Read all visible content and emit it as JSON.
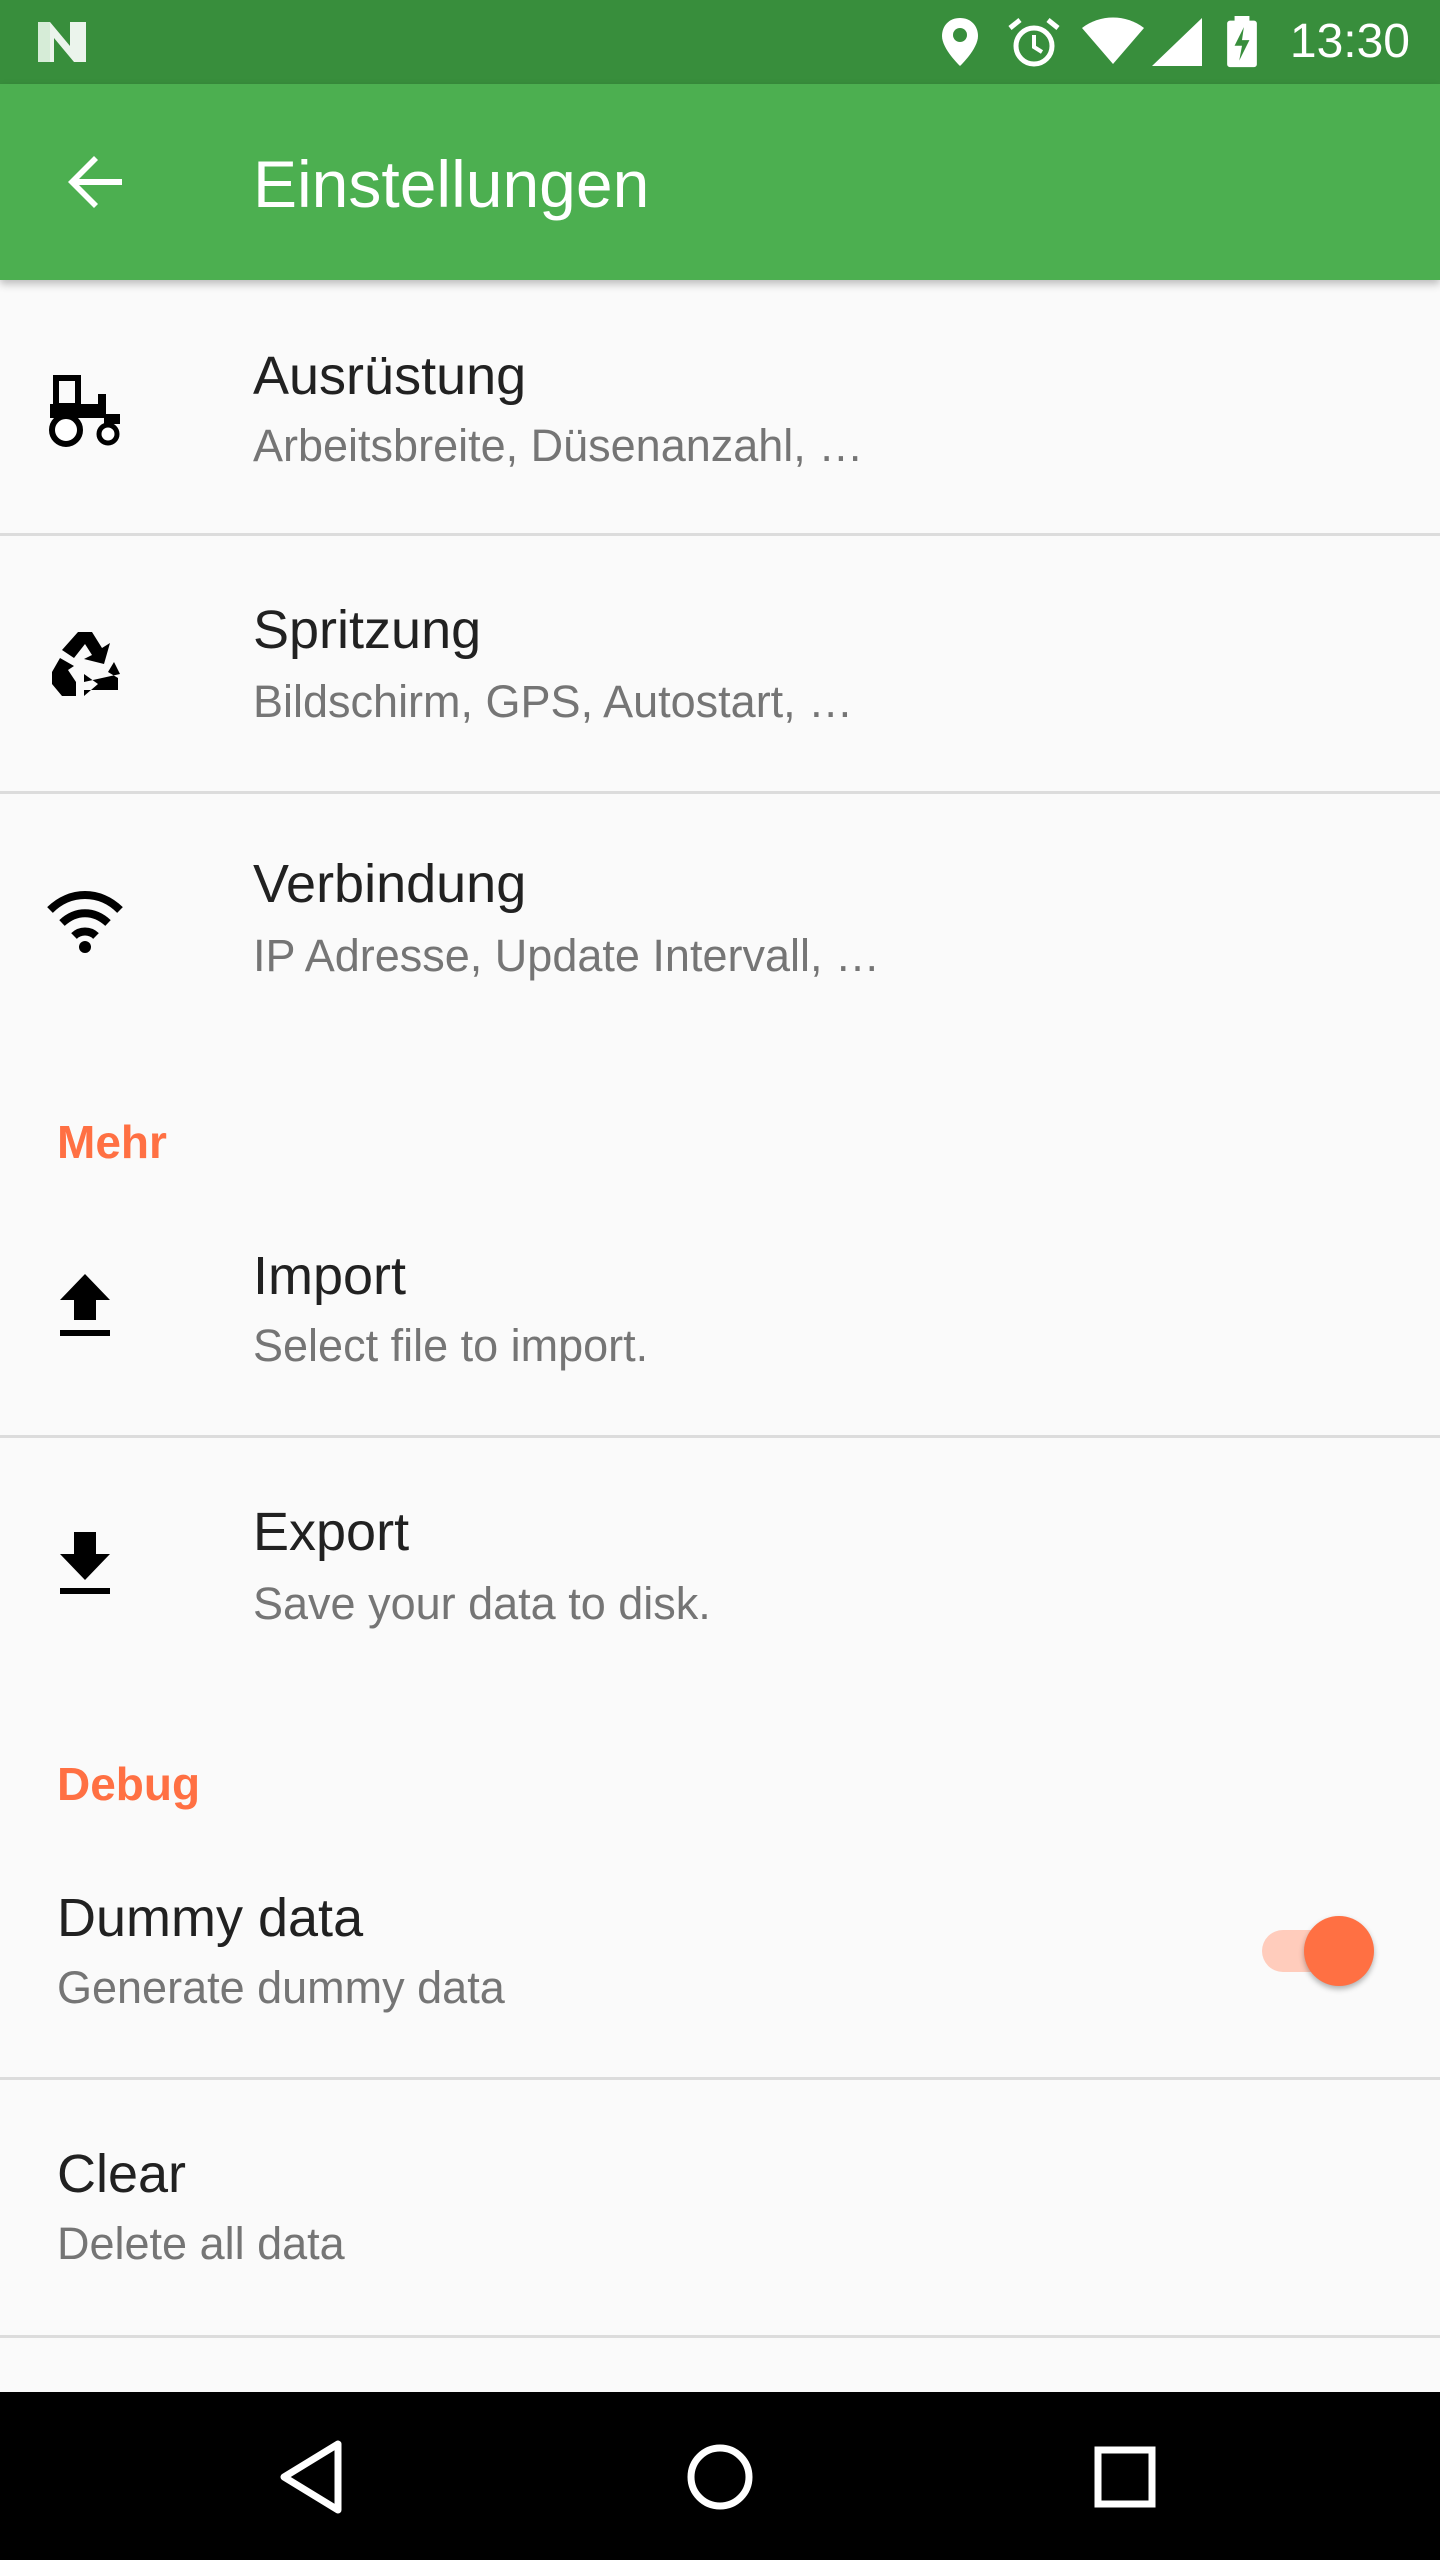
{
  "status_bar": {
    "time": "13:30",
    "icons": [
      "notification-n-icon",
      "location-icon",
      "alarm-icon",
      "wifi-icon",
      "cell-signal-icon",
      "battery-charging-icon"
    ]
  },
  "app_bar": {
    "title": "Einstellungen",
    "back_icon": "arrow-back-icon"
  },
  "preferences": [
    {
      "title": "Ausrüstung",
      "summary": "Arbeitsbreite, Düsenanzahl, …",
      "icon": "tractor-icon"
    },
    {
      "title": "Spritzung",
      "summary": "Bildschirm, GPS, Autostart, …",
      "icon": "recycle-icon"
    },
    {
      "title": "Verbindung",
      "summary": "IP Adresse, Update Intervall, …",
      "icon": "wifi-icon"
    }
  ],
  "categories": {
    "more": {
      "title": "Mehr",
      "items": [
        {
          "title": "Import",
          "summary": "Select file to import.",
          "icon": "upload-icon"
        },
        {
          "title": "Export",
          "summary": "Save your data to disk.",
          "icon": "download-icon"
        }
      ]
    },
    "debug": {
      "title": "Debug",
      "items": [
        {
          "title": "Dummy data",
          "summary": "Generate dummy data",
          "switch_on": true
        },
        {
          "title": "Clear",
          "summary": "Delete all data"
        }
      ]
    }
  },
  "colors": {
    "status_bar": "#388e3c",
    "app_bar": "#4caf50",
    "accent": "#ff7043",
    "background": "#fafafa"
  },
  "nav_bar": {
    "buttons": [
      "back-triangle-icon",
      "home-circle-icon",
      "recents-square-icon"
    ]
  }
}
